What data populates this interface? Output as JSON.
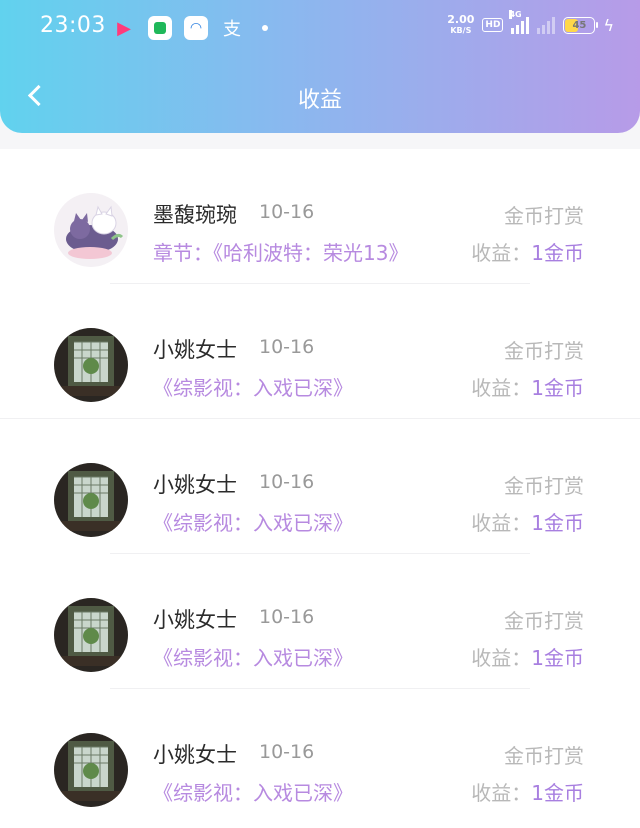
{
  "status_bar": {
    "time": "23:03",
    "net_speed": "2.00",
    "net_unit": "KB/S",
    "hd": "HD",
    "network": "4G",
    "battery": "45",
    "app_icons": [
      "youku-icon",
      "green-app-icon",
      "browser-icon",
      "alipay-icon"
    ]
  },
  "header": {
    "title": "收益"
  },
  "earnings": [
    {
      "name": "墨馥琬琬",
      "date": "10-16",
      "type": "金币打赏",
      "book": "章节：《哈利波特：荣光13》",
      "label": "收益：",
      "value": "1金币"
    },
    {
      "name": "小姚女士",
      "date": "10-16",
      "type": "金币打赏",
      "book": "《综影视：入戏已深》",
      "label": "收益：",
      "value": "1金币"
    },
    {
      "name": "小姚女士",
      "date": "10-16",
      "type": "金币打赏",
      "book": "《综影视：入戏已深》",
      "label": "收益：",
      "value": "1金币"
    },
    {
      "name": "小姚女士",
      "date": "10-16",
      "type": "金币打赏",
      "book": "《综影视：入戏已深》",
      "label": "收益：",
      "value": "1金币"
    },
    {
      "name": "小姚女士",
      "date": "10-16",
      "type": "金币打赏",
      "book": "《综影视：入戏已深》",
      "label": "收益：",
      "value": "1金币"
    }
  ],
  "colors": {
    "accent": "#b78ae0",
    "header_start": "#61d2ee",
    "header_end": "#b79be8"
  }
}
